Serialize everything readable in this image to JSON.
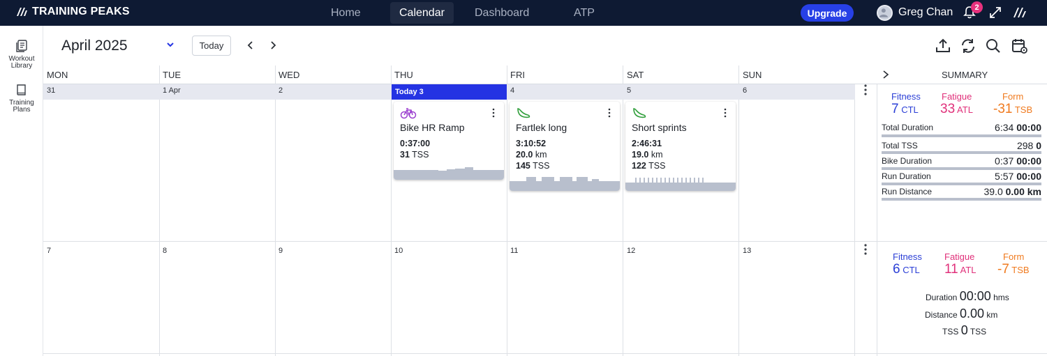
{
  "app": {
    "brand": "TRAINING PEAKS"
  },
  "nav": {
    "items": [
      "Home",
      "Calendar",
      "Dashboard",
      "ATP"
    ],
    "active": "Calendar"
  },
  "header": {
    "upgrade_label": "Upgrade",
    "user_name": "Greg Chan",
    "notification_count": "2"
  },
  "rail": {
    "items": [
      {
        "label_1": "Workout",
        "label_2": "Library"
      },
      {
        "label_1": "Training",
        "label_2": "Plans"
      }
    ]
  },
  "toolbar": {
    "month_label": "April 2025",
    "today_label": "Today"
  },
  "calendar": {
    "days": [
      "MON",
      "TUE",
      "WED",
      "THU",
      "FRI",
      "SAT",
      "SUN"
    ],
    "summary_label": "SUMMARY",
    "week1_dates": [
      "31",
      "1 Apr",
      "2",
      "Today 3",
      "4",
      "5",
      "6"
    ],
    "week2_dates": [
      "7",
      "8",
      "9",
      "10",
      "11",
      "12",
      "13"
    ]
  },
  "workouts": [
    {
      "sport": "bike",
      "title": "Bike HR Ramp",
      "duration": "0:37:00",
      "distance": "",
      "distance_unit": "",
      "tss": "31",
      "tss_unit": "TSS"
    },
    {
      "sport": "run",
      "title": "Fartlek long",
      "duration": "3:10:52",
      "distance": "20.0",
      "distance_unit": "km",
      "tss": "145",
      "tss_unit": "TSS"
    },
    {
      "sport": "run",
      "title": "Short sprints",
      "duration": "2:46:31",
      "distance": "19.0",
      "distance_unit": "km",
      "tss": "122",
      "tss_unit": "TSS"
    }
  ],
  "summary_week1": {
    "fitness_label": "Fitness",
    "fitness_value": "7",
    "fitness_unit": "CTL",
    "fatigue_label": "Fatigue",
    "fatigue_value": "33",
    "fatigue_unit": "ATL",
    "form_label": "Form",
    "form_value": "-31",
    "form_unit": "TSB",
    "rows": [
      {
        "label": "Total Duration",
        "planned": "6:34",
        "completed": "00:00"
      },
      {
        "label": "Total TSS",
        "planned": "298",
        "completed": "0"
      },
      {
        "label": "Bike Duration",
        "planned": "0:37",
        "completed": "00:00"
      },
      {
        "label": "Run Duration",
        "planned": "5:57",
        "completed": "00:00"
      },
      {
        "label": "Run Distance",
        "planned": "39.0",
        "completed": "0.00 km"
      }
    ]
  },
  "summary_week2": {
    "fitness_label": "Fitness",
    "fitness_value": "6",
    "fitness_unit": "CTL",
    "fatigue_label": "Fatigue",
    "fatigue_value": "11",
    "fatigue_unit": "ATL",
    "form_label": "Form",
    "form_value": "-7",
    "form_unit": "TSB",
    "duration_label": "Duration",
    "duration_value": "00:00",
    "duration_unit": "hms",
    "distance_label": "Distance",
    "distance_value": "0.00",
    "distance_unit": "km",
    "tss_label": "TSS",
    "tss_value": "0",
    "tss_unit": "TSS"
  },
  "colors": {
    "accent": "#2433e3",
    "nav_bg": "#0e1a33",
    "fitness": "#2b3fd6",
    "fatigue": "#e0307a",
    "form": "#f07a1e",
    "run": "#2f9e3a",
    "bike": "#9b3fcf"
  },
  "icons": {
    "rail": [
      "workout-library-icon",
      "training-plans-icon"
    ],
    "toolbar": [
      "upload-icon",
      "sync-icon",
      "search-icon",
      "calendar-settings-icon"
    ]
  }
}
